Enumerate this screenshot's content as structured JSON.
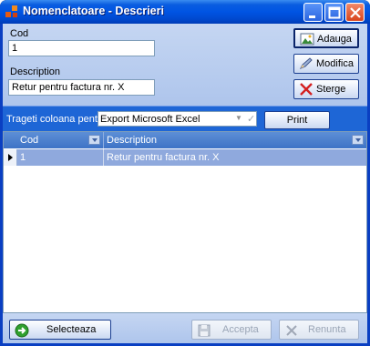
{
  "window": {
    "title": "Nomenclatoare - Descrieri",
    "controls": [
      "minimize-icon",
      "maximize-icon",
      "close-icon"
    ]
  },
  "form": {
    "cod_label": "Cod",
    "cod_value": "1",
    "description_label": "Description",
    "description_value": "Retur pentru factura nr. X"
  },
  "side_buttons": {
    "add": "Adauga",
    "modify": "Modifica",
    "delete": "Sterge"
  },
  "print_bar": {
    "label": "Trageti coloana pentru grupare",
    "export_value": "Export Microsoft Excel",
    "print_label": "Print"
  },
  "grid": {
    "columns": [
      "Cod",
      "Description"
    ],
    "rows": [
      {
        "cod": "1",
        "description": "Retur pentru factura nr. X"
      }
    ]
  },
  "bottom_buttons": {
    "select": "Selecteaza",
    "accept": "Accepta",
    "cancel": "Renunta"
  },
  "colors": {
    "titlebar": "#0054e3",
    "panel": "#c5d6f2",
    "selected_row": "#8fa9dd",
    "grid_header": "#4a7fd0"
  }
}
